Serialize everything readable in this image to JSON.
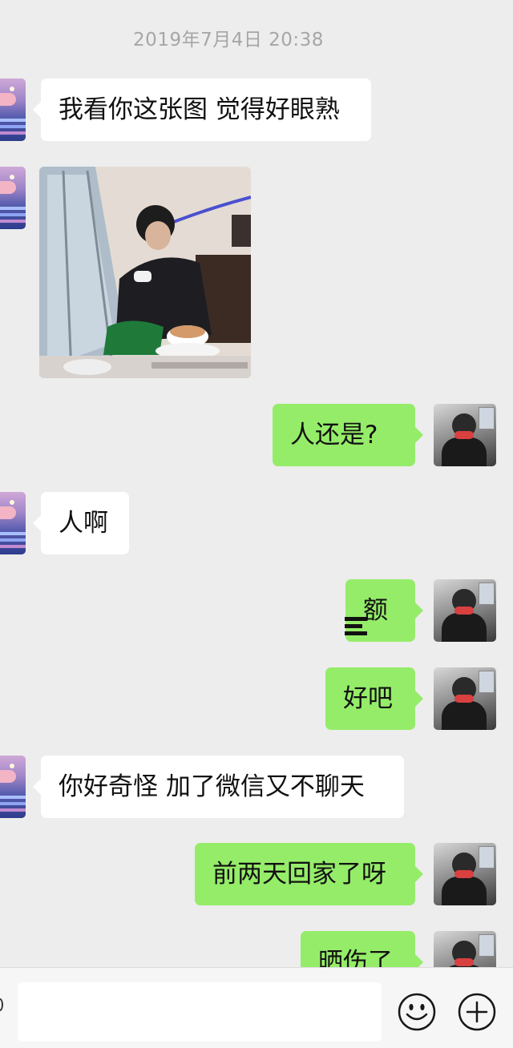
{
  "timestamp": "2019年7月4日 20:38",
  "messages": [
    {
      "side": "left",
      "type": "text",
      "text": "我看你这张图 觉得好眼熟"
    },
    {
      "side": "left",
      "type": "image",
      "image_desc": "photo-message"
    },
    {
      "side": "right",
      "type": "text",
      "text": "人还是?"
    },
    {
      "side": "left",
      "type": "text",
      "text": "人啊"
    },
    {
      "side": "right",
      "type": "text",
      "text": "额"
    },
    {
      "side": "right",
      "type": "text",
      "text": "好吧"
    },
    {
      "side": "left",
      "type": "text",
      "text": "你好奇怪  加了微信又不聊天"
    },
    {
      "side": "right",
      "type": "text",
      "text": "前两天回家了呀"
    },
    {
      "side": "right",
      "type": "text",
      "text": "晒伤了"
    }
  ],
  "input_bar": {
    "placeholder": "",
    "emoji_icon": "emoji-icon",
    "plus_icon": "plus-icon"
  },
  "colors": {
    "background": "#ededed",
    "bubble_self": "#95ec69",
    "bubble_other": "#ffffff",
    "timestamp": "#a6a6a6"
  }
}
